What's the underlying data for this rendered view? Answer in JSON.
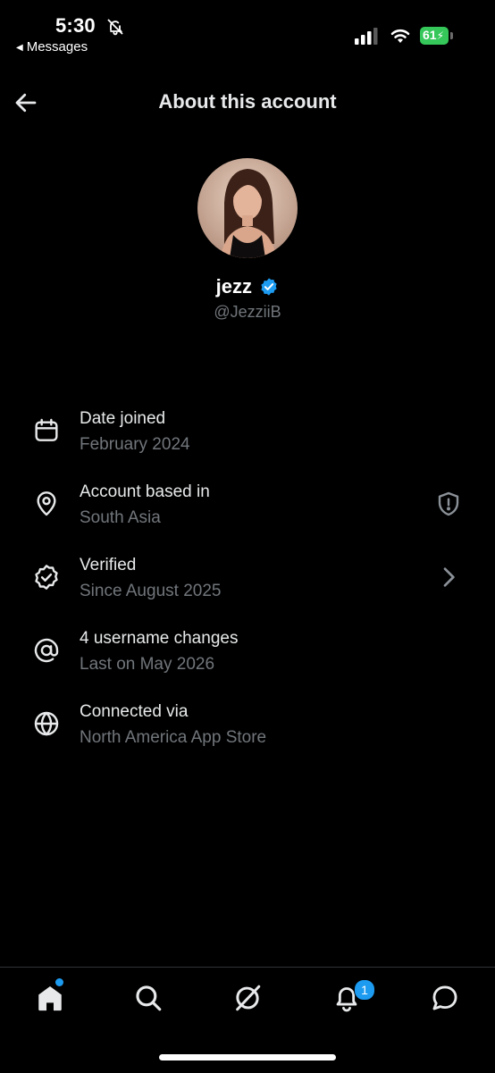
{
  "status_bar": {
    "time": "5:30",
    "back_app": "Messages",
    "battery_level": "61",
    "battery_color": "#35c759"
  },
  "header": {
    "title": "About this account",
    "back_icon": "arrow-left-icon"
  },
  "profile": {
    "name": "jezz",
    "handle": "@JezziiB",
    "verified": true,
    "verified_color": "#1d9bf0"
  },
  "info_rows": [
    {
      "icon": "calendar-icon",
      "label": "Date joined",
      "value": "February 2024"
    },
    {
      "icon": "location-pin-icon",
      "label": "Account based in",
      "value": "South Asia",
      "trailing_icon": "shield-alert-icon"
    },
    {
      "icon": "verified-seal-icon",
      "label": "Verified",
      "value": "Since August 2025",
      "trailing_icon": "chevron-right-icon"
    },
    {
      "icon": "at-sign-icon",
      "label": "4 username changes",
      "value": "Last on May 2026"
    },
    {
      "icon": "globe-icon",
      "label": "Connected via",
      "value": "North America App Store"
    }
  ],
  "tab_bar": {
    "tabs": [
      "home-icon",
      "search-icon",
      "grok-icon",
      "notifications-icon",
      "messages-icon"
    ],
    "notifications_badge": "1",
    "accent": "#1d9bf0"
  }
}
